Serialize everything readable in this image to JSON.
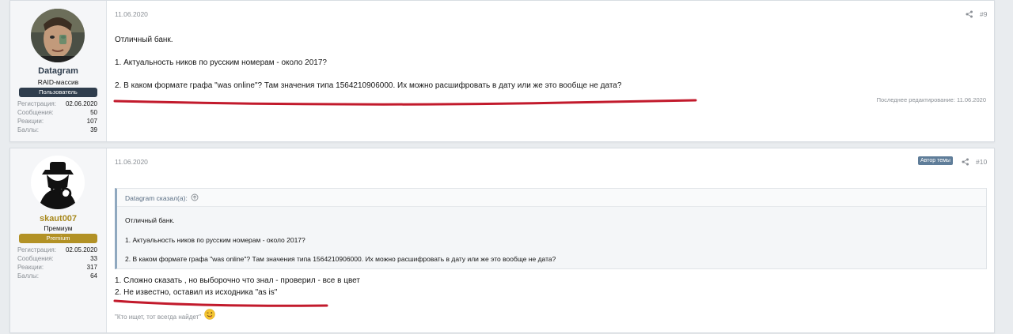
{
  "posts": [
    {
      "user": {
        "name": "Datagram",
        "title": "RAID-массив",
        "banner": "Пользователь",
        "stats": [
          {
            "label": "Регистрация:",
            "value": "02.06.2020"
          },
          {
            "label": "Сообщения:",
            "value": "50"
          },
          {
            "label": "Реакции:",
            "value": "107"
          },
          {
            "label": "Баллы:",
            "value": "39"
          }
        ]
      },
      "date": "11.06.2020",
      "number": "#9",
      "body": [
        "Отличный банк.",
        "1. Актуальность ников по русским номерам - около 2017?",
        "2. В каком формате графа \"was online\"? Там значения типа 1564210906000. Их можно расшифровать в дату или же это вообще не дата?"
      ],
      "edited": "Последнее редактирование: 11.06.2020"
    },
    {
      "user": {
        "name": "skaut007",
        "title": "Премиум",
        "banner": "Premium",
        "stats": [
          {
            "label": "Регистрация:",
            "value": "02.05.2020"
          },
          {
            "label": "Сообщения:",
            "value": "33"
          },
          {
            "label": "Реакции:",
            "value": "317"
          },
          {
            "label": "Баллы:",
            "value": "64"
          }
        ]
      },
      "date": "11.06.2020",
      "badge": "Автор темы",
      "number": "#10",
      "quote": {
        "author": "Datagram сказал(а):",
        "lines": [
          "Отличный банк.",
          "1. Актуальность ников по русским номерам - около 2017?",
          "2. В каком формате графа \"was online\"? Там значения типа 1564210906000. Их можно расшифровать в дату или же это вообще не дата?"
        ]
      },
      "body": [
        "1. Сложно сказать , но выборочно что знал - проверил - все в цвет",
        "2. Не известно, оставил из исходника \"as is\""
      ],
      "signature": "\"Кто ищет, тот всегда найдет\""
    }
  ],
  "colors": {
    "user_banner": "#2f3d4d",
    "premium_banner": "#b29125",
    "username_1": "#2f3d4d",
    "username_2": "#a8891e",
    "underline": "#c21a2c"
  }
}
